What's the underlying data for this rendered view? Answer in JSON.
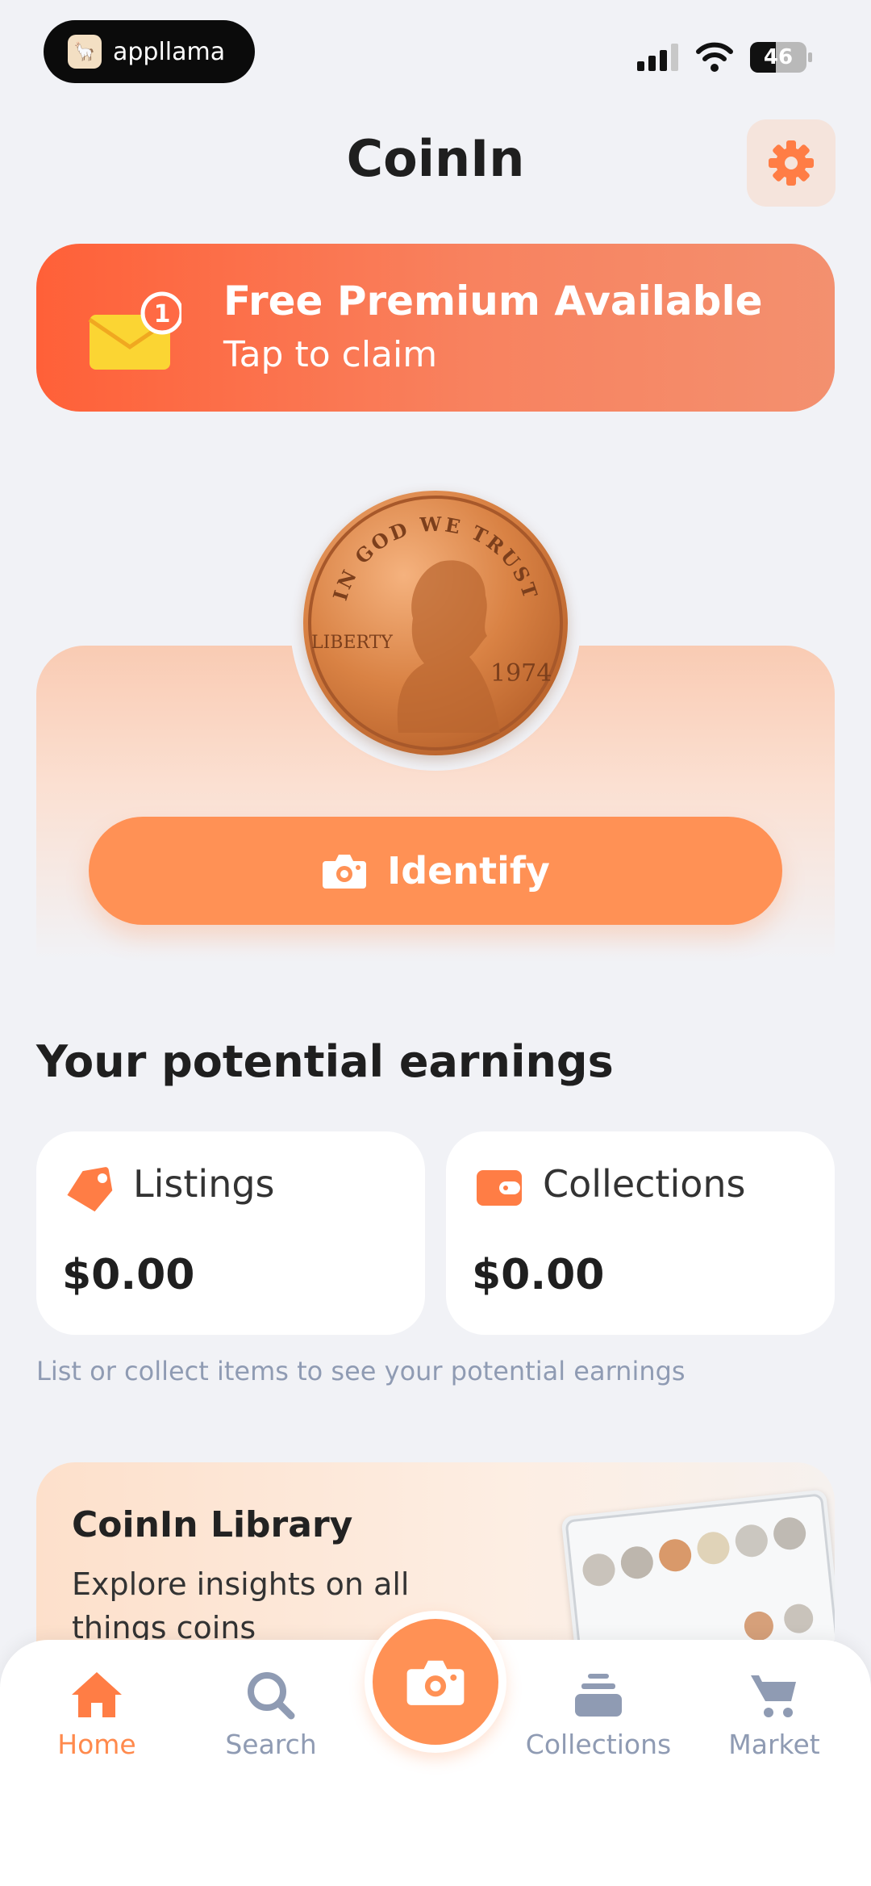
{
  "status_bar": {
    "carrier_name": "appllama",
    "battery_level": "46"
  },
  "header": {
    "title": "CoinIn"
  },
  "promo": {
    "title": "Free Premium Available",
    "subtitle": "Tap to claim",
    "badge_count": "1"
  },
  "hero": {
    "coin_motto": "IN GOD WE TRUST",
    "coin_word": "LIBERTY",
    "coin_year": "1974",
    "identify_label": "Identify"
  },
  "earnings": {
    "title": "Your potential earnings",
    "cards": [
      {
        "label": "Listings",
        "value": "$0.00",
        "icon": "tag-icon"
      },
      {
        "label": "Collections",
        "value": "$0.00",
        "icon": "wallet-icon"
      }
    ],
    "hint": "List or collect items to see your potential earnings"
  },
  "library": {
    "title": "CoinIn Library",
    "description": "Explore insights on all things coins"
  },
  "nav": {
    "items": [
      {
        "label": "Home",
        "icon": "home-icon",
        "active": true
      },
      {
        "label": "Search",
        "icon": "search-icon",
        "active": false
      },
      {
        "label": "Collections",
        "icon": "collections-icon",
        "active": false
      },
      {
        "label": "Market",
        "icon": "cart-icon",
        "active": false
      }
    ],
    "center_action": "camera-icon"
  },
  "colors": {
    "accent": "#ff9155",
    "promo_start": "#ff6038",
    "background": "#f1f2f6",
    "nav_inactive": "#8f9bb3",
    "icon_orange": "#ff7d45"
  }
}
